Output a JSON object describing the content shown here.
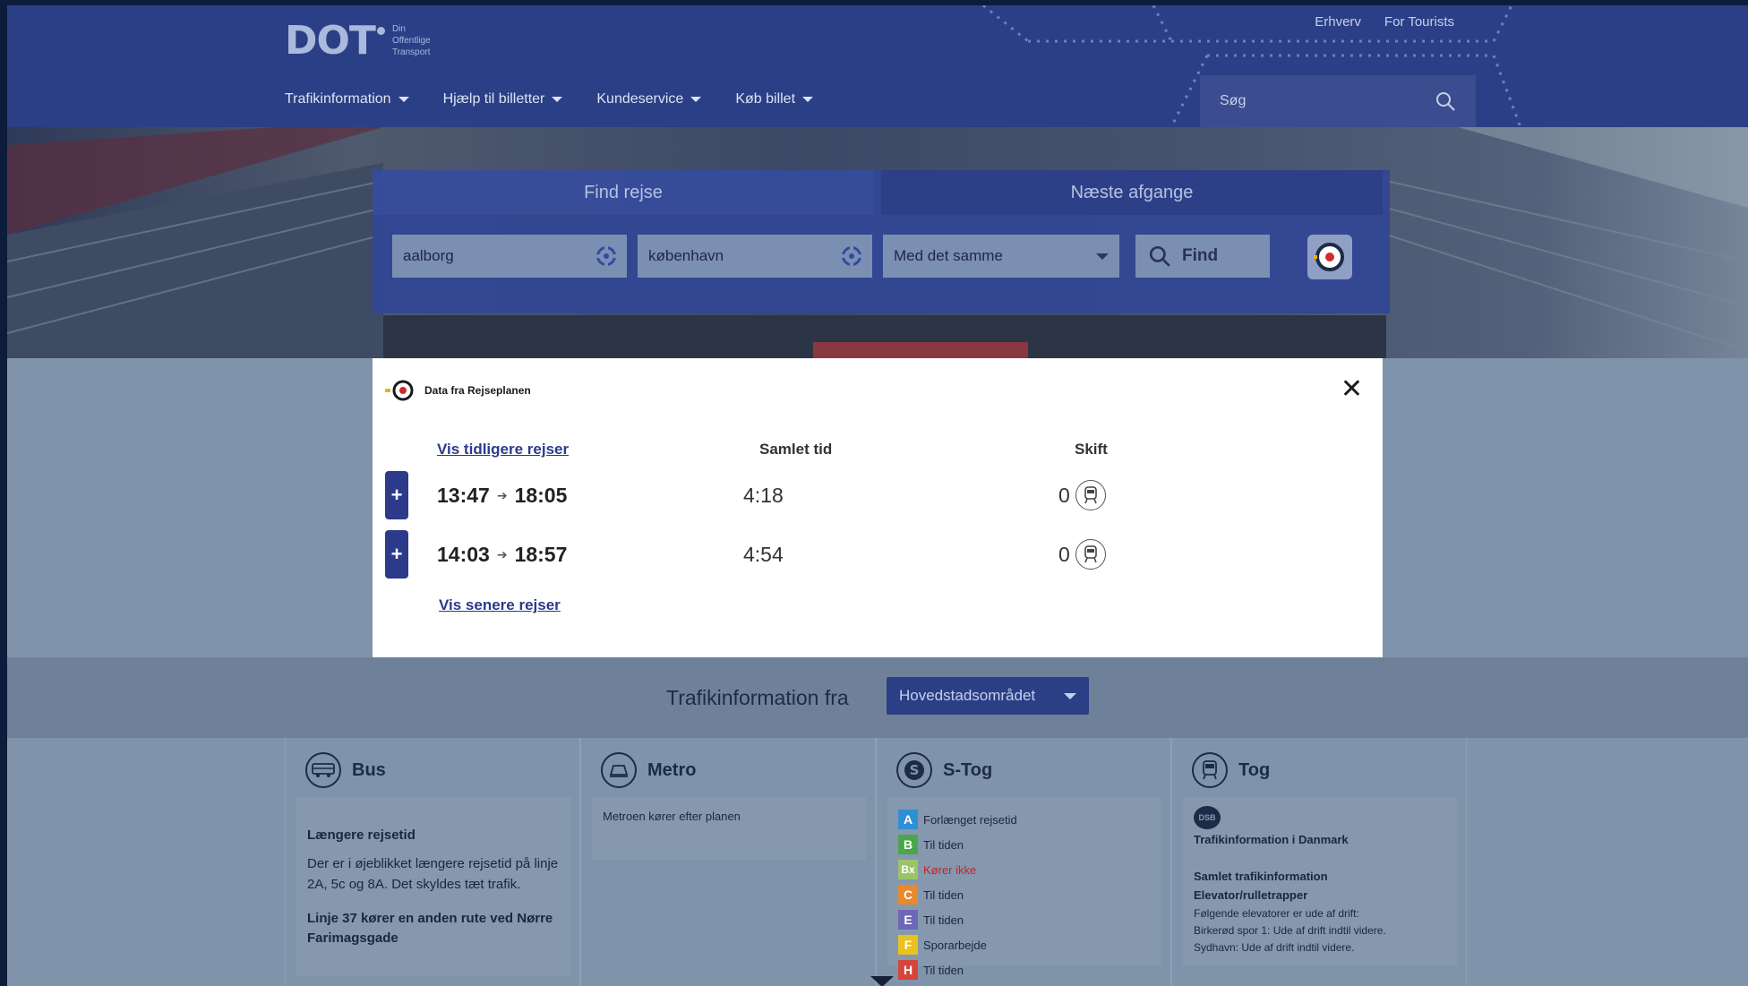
{
  "brand": {
    "logo": "DOT",
    "tagline": [
      "Din",
      "Offentlige",
      "Transport"
    ]
  },
  "top_links": [
    "Erhverv",
    "For Tourists"
  ],
  "nav": [
    "Trafikinformation",
    "Hjælp til billetter",
    "Kundeservice",
    "Køb billet"
  ],
  "search": {
    "placeholder": "Søg"
  },
  "journey": {
    "tabs": [
      "Find rejse",
      "Næste afgange"
    ],
    "from": "aalborg",
    "to": "københavn",
    "departure_option": "Med det samme",
    "find_label": "Find"
  },
  "results": {
    "source_label": "Data fra Rejseplanen",
    "earlier_link": "Vis tidligere rejser",
    "col_time": "Samlet tid",
    "col_changes": "Skift",
    "rows": [
      {
        "depart": "13:47",
        "arrive": "18:05",
        "duration": "4:18",
        "changes": "0"
      },
      {
        "depart": "14:03",
        "arrive": "18:57",
        "duration": "4:54",
        "changes": "0"
      }
    ],
    "later_link": "Vis senere rejser",
    "expand_glyph": "+",
    "close_glyph": "✕"
  },
  "traffic": {
    "title": "Trafikinformation fra",
    "region": "Hovedstadsområdet",
    "cards": [
      {
        "name": "Bus",
        "heading": "Længere rejsetid",
        "text": "Der er i øjeblikket længere rejsetid på linje 2A, 5c og 8A. Det skyldes tæt trafik.",
        "heading2": "Linje 37 kører en anden rute ved Nørre Farimagsgade"
      },
      {
        "name": "Metro",
        "text": "Metroen kører efter planen"
      },
      {
        "name": "S-Tog",
        "lines": [
          {
            "line": "A",
            "status": "Forlænget rejsetid",
            "color": "#2f8fd6"
          },
          {
            "line": "B",
            "status": "Til tiden",
            "color": "#4aa64a"
          },
          {
            "line": "Bx",
            "status": "Kører ikke",
            "color": "#9bc46a",
            "alert": true
          },
          {
            "line": "C",
            "status": "Til tiden",
            "color": "#e8892a"
          },
          {
            "line": "E",
            "status": "Til tiden",
            "color": "#6d67b8"
          },
          {
            "line": "F",
            "status": "Sporarbejde",
            "color": "#e8c21d"
          },
          {
            "line": "H",
            "status": "Til tiden",
            "color": "#d6453b"
          }
        ]
      },
      {
        "name": "Tog",
        "dsb": "DSB",
        "heading": "Trafikinformation i Danmark",
        "sub1": "Samlet trafikinformation",
        "sub2": "Elevator/rulletrapper",
        "text1": "Følgende elevatorer er ude af drift:",
        "text2": "Birkerød spor 1: Ude af drift indtil videre.",
        "text3": "Sydhavn:  Ude af drift indtil videre."
      }
    ]
  },
  "colors": {
    "header": "#2b3f86",
    "accent": "#2d3a8a",
    "alert": "#c0282d"
  }
}
